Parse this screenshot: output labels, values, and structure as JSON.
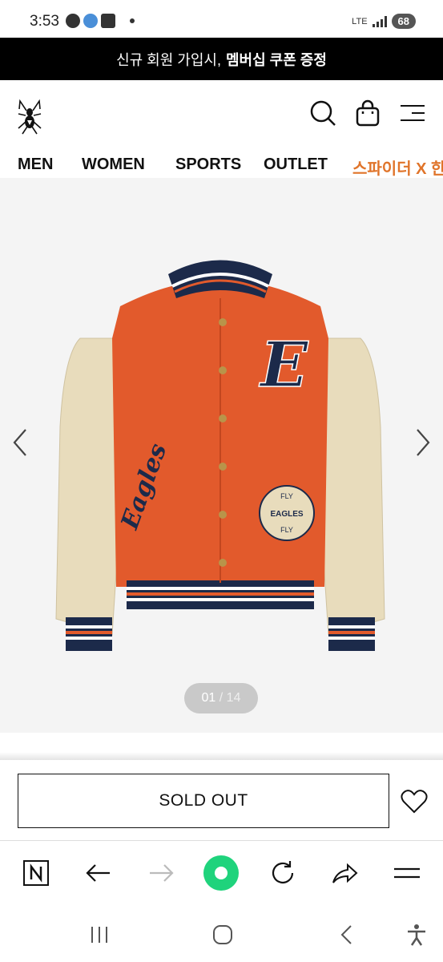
{
  "status_bar": {
    "time": "3:53",
    "network": "LTE",
    "battery": "68"
  },
  "promo": {
    "text": "신규 회원 가입시,",
    "highlight": "멤버십 쿠폰 증정"
  },
  "nav": {
    "items": [
      "MEN",
      "WOMEN",
      "SPORTS",
      "OUTLET",
      "스파이더 X 한"
    ]
  },
  "product": {
    "image_counter_current": "01",
    "image_counter_total": "/ 14",
    "jacket_text": {
      "script_letter": "E",
      "sleeve_script": "Eagles",
      "patch_top": "FLY",
      "patch_middle": "EAGLES",
      "patch_bottom": "FLY"
    }
  },
  "actions": {
    "sold_out_label": "SOLD OUT"
  },
  "colors": {
    "banner_bg": "#000000",
    "nav_highlight": "#e0742a",
    "jacket_body": "#e25a2c",
    "jacket_sleeve": "#e8dcbc",
    "jacket_navy": "#1c2a4a",
    "browser_home": "#1fd37c"
  },
  "icons": {
    "header": [
      "spider-logo",
      "search-icon",
      "shopping-bag-icon",
      "menu-icon"
    ],
    "browser": [
      "naver-n-icon",
      "back-arrow-icon",
      "forward-arrow-icon",
      "home-dot-icon",
      "reload-icon",
      "share-icon",
      "menu-icon"
    ],
    "android": [
      "recent-apps-icon",
      "home-icon",
      "back-icon",
      "accessibility-icon"
    ]
  }
}
